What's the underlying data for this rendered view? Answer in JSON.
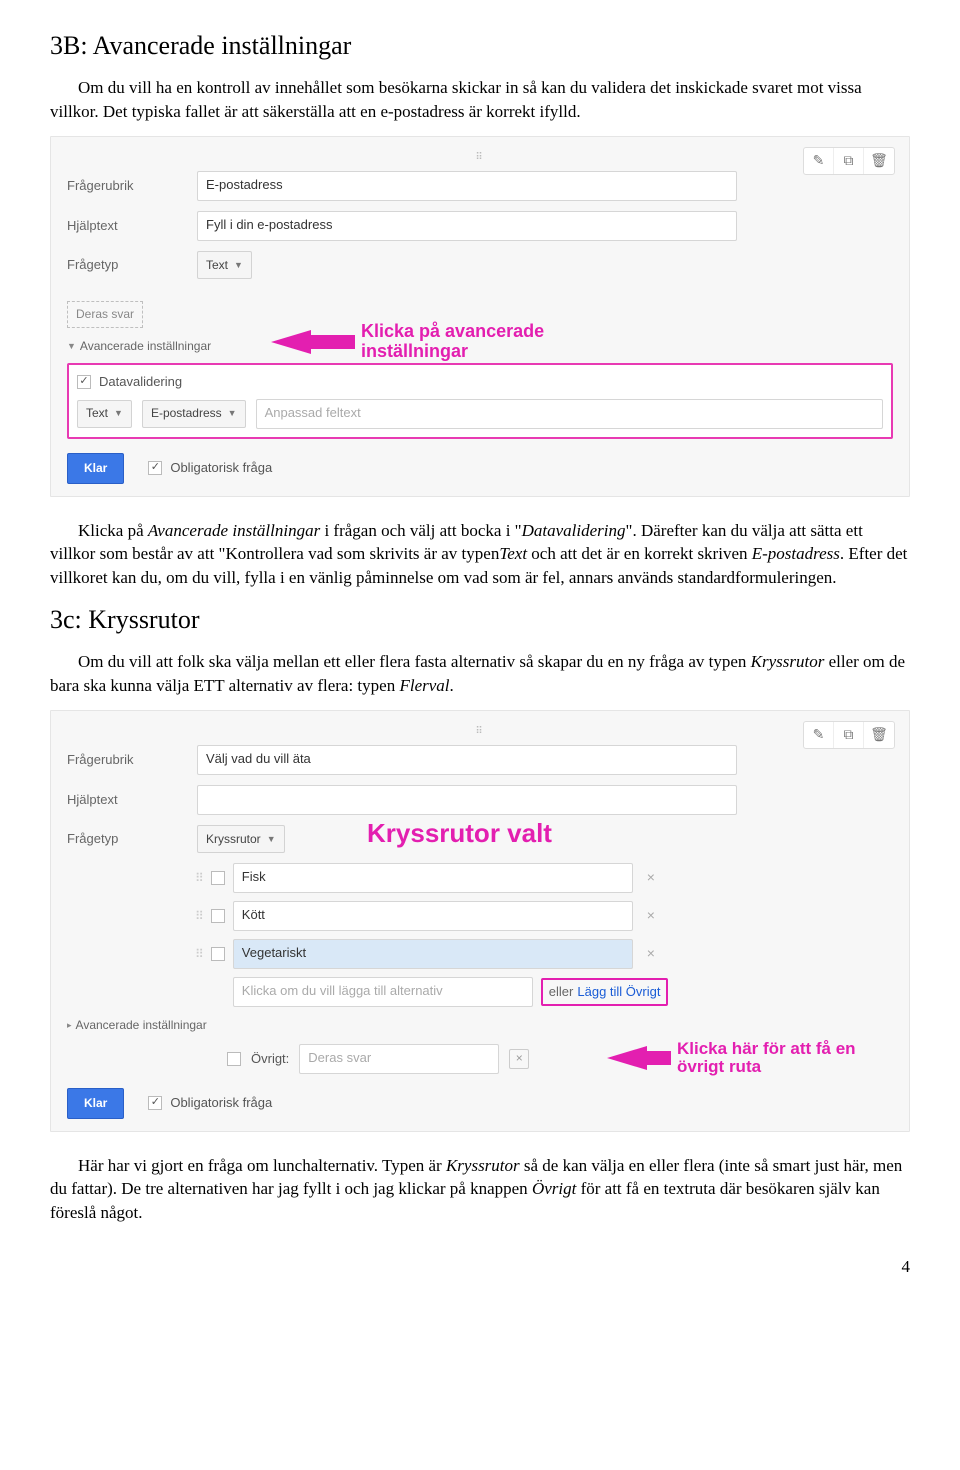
{
  "section1": {
    "heading": "3B: Avancerade inställningar",
    "para1": "Om du vill ha en kontroll av innehållet som besökarna skickar in så kan du validera det inskickade svaret mot vissa villkor. Det typiska fallet är att säkerställa att en e-postadress är korrekt ifylld.",
    "para2a": "Klicka på ",
    "para2b": "Avancerade inställningar",
    "para2c": " i frågan och välj att bocka i \"",
    "para2d": "Datavalidering",
    "para2e": "\". Därefter kan du välja att sätta ett villkor som består av att \"Kontrollera vad som skrivits är av typen",
    "para2f": "Text",
    "para2g": " och att det är en korrekt skriven ",
    "para2h": "E-postadress",
    "para2i": ". Efter det villkoret kan du, om du vill, fylla i en vänlig påminnelse om vad som är fel, annars används standardformuleringen."
  },
  "panel1": {
    "label_rubrik": "Frågerubrik",
    "input_rubrik": "E-postadress",
    "label_help": "Hjälptext",
    "input_help": "Fyll i din e-postadress",
    "label_type": "Frågetyp",
    "type_value": "Text",
    "their_answer": "Deras svar",
    "adv_label": "Avancerade inställningar",
    "callout_text": "Klicka på avancerade inställningar",
    "datavalidation": "Datavalidering",
    "val_type": "Text",
    "val_sub": "E-postadress",
    "val_placeholder": "Anpassad feltext",
    "klar": "Klar",
    "mandatory": "Obligatorisk fråga"
  },
  "section2": {
    "heading": "3c: Kryssrutor",
    "para1a": "Om du vill att folk ska välja mellan ett eller flera fasta alternativ så skapar du en ny fråga av typen ",
    "para1b": "Kryssrutor",
    "para1c": " eller om de bara ska kunna välja ETT alternativ av flera: typen ",
    "para1d": "Flerval",
    "para1e": "."
  },
  "panel2": {
    "label_rubrik": "Frågerubrik",
    "input_rubrik": "Välj vad du vill äta",
    "label_help": "Hjälptext",
    "label_type": "Frågetyp",
    "type_value": "Kryssrutor",
    "callout_big": "Kryssrutor valt",
    "opt1": "Fisk",
    "opt2": "Kött",
    "opt3": "Vegetariskt",
    "add_placeholder": "Klicka om du vill lägga till alternativ",
    "or_text": "eller",
    "add_other": "Lägg till Övrigt",
    "adv_label": "Avancerade inställningar",
    "ovrigt_label": "Övrigt:",
    "ovrigt_placeholder": "Deras svar",
    "callout2": "Klicka här för att få en övrigt ruta",
    "klar": "Klar",
    "mandatory": "Obligatorisk fråga"
  },
  "closing": {
    "para_a": "Här har vi gjort en fråga om lunchalternativ. Typen är ",
    "para_b": "Kryssrutor",
    "para_c": " så de kan välja en eller flera (inte så smart just här, men du fattar). De tre alternativen har jag fyllt i och jag klickar på knappen ",
    "para_d": "Övrigt",
    "para_e": " för att få en textruta där besökaren själv kan föreslå något."
  },
  "page_number": "4"
}
